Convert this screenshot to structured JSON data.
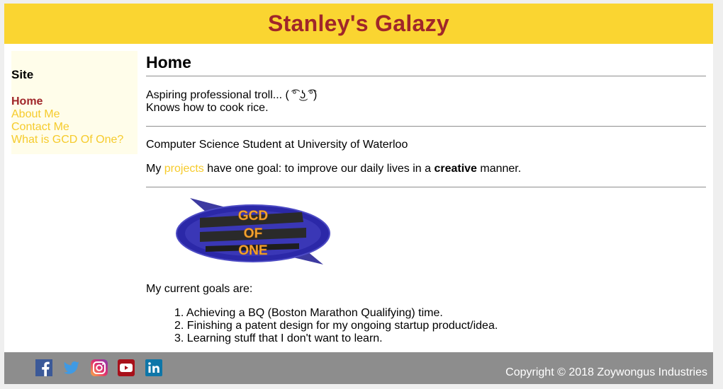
{
  "header": {
    "title": "Stanley's Galazy"
  },
  "sidebar": {
    "heading": "Site",
    "items": [
      {
        "label": "Home",
        "active": true
      },
      {
        "label": "About Me",
        "active": false
      },
      {
        "label": "Contact Me",
        "active": false
      },
      {
        "label": "What is GCD Of One?",
        "active": false
      }
    ]
  },
  "main": {
    "heading": "Home",
    "intro": {
      "line1": "Aspiring professional troll... ( ͡° ͜ʖ ͡°)",
      "line2": "Knows how to cook rice."
    },
    "bio": "Computer Science Student at University of Waterloo",
    "projects_sentence": {
      "before": "My ",
      "link": "projects",
      "middle": " have one goal: to improve our daily lives in a ",
      "bold": "creative",
      "after": " manner."
    },
    "logo": {
      "line1": "GCD",
      "line2": "OF",
      "line3": "ONE"
    },
    "goals_intro": "My current goals are:",
    "goals": [
      "1. Achieving a BQ (Boston Marathon Qualifying) time.",
      "2. Finishing a patent design for my ongoing startup product/idea.",
      "3. Learning stuff that I don't want to learn."
    ]
  },
  "footer": {
    "social_icons": [
      "facebook-icon",
      "twitter-icon",
      "instagram-icon",
      "youtube-icon",
      "linkedin-icon"
    ],
    "copyright": "Copyright © 2018 Zoywongus Industries"
  },
  "colors": {
    "header_bg": "#fad531",
    "title": "#a0262a",
    "link": "#f6cb2c",
    "sidebar_bg": "#fffdea",
    "footer_bg": "#8d8d8d"
  }
}
